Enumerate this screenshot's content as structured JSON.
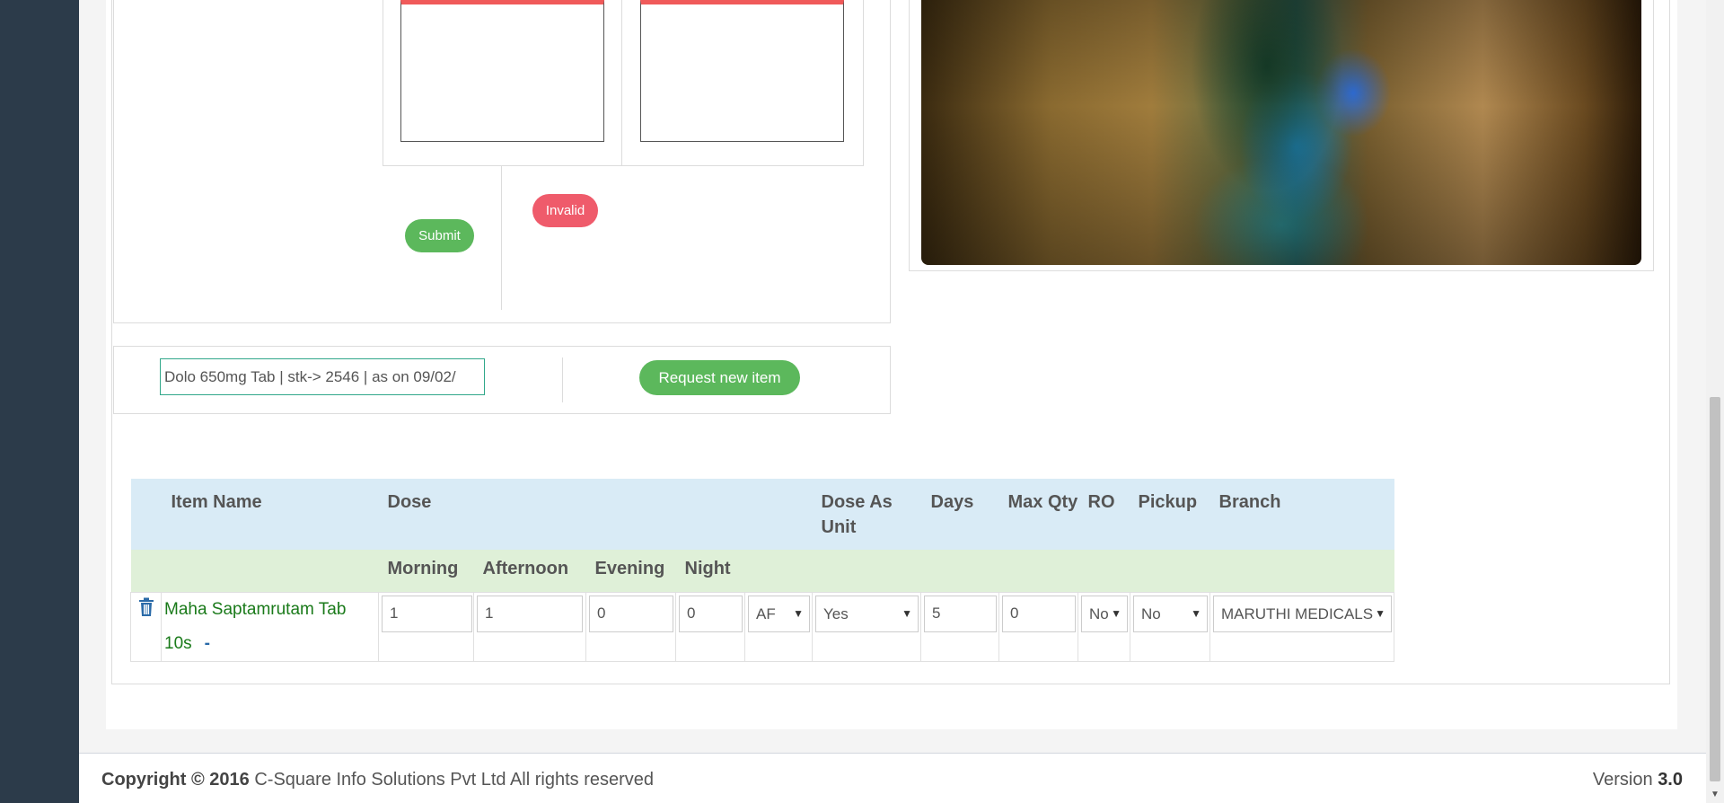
{
  "signature_panel": {
    "submit_label": "Submit",
    "invalid_label": "Invalid"
  },
  "item_search": {
    "value": "Dolo 650mg Tab | stk-> 2546 | as on 09/02/",
    "request_label": "Request new item"
  },
  "table": {
    "headers": {
      "item_name": "Item Name",
      "dose": "Dose",
      "dose_as_unit": "Dose As Unit",
      "days": "Days",
      "max_qty": "Max Qty",
      "ro": "RO",
      "pickup": "Pickup",
      "branch": "Branch"
    },
    "subheaders": {
      "morning": "Morning",
      "afternoon": "Afternoon",
      "evening": "Evening",
      "night": "Night"
    },
    "rows": [
      {
        "item_name": "Maha Saptamrutam Tab 10s",
        "remove_symbol": "-",
        "morning": "1",
        "afternoon": "1",
        "evening": "0",
        "night": "0",
        "timing": "AF",
        "dose_as_unit": "Yes",
        "days": "5",
        "max_qty": "0",
        "ro": "No",
        "pickup": "No",
        "branch": "MARUTHI MEDICALS"
      }
    ]
  },
  "footer": {
    "copyright_label": "Copyright © 2016",
    "company": "C-Square Info Solutions Pvt Ltd All rights reserved",
    "version_label": "Version",
    "version_number": "3.0"
  }
}
